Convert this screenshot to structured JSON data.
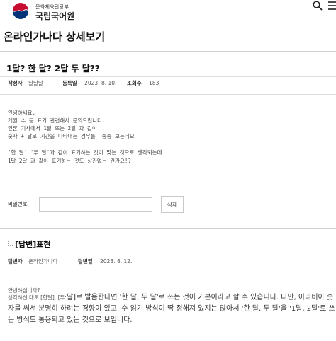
{
  "header": {
    "org_small": "문화체육관광부",
    "org_big": "국립국어원"
  },
  "page_title": "온라인가나다 상세보기",
  "question": {
    "title": "1달? 한 달? 2달 두 달??",
    "author_label": "작성자",
    "author": "달달달",
    "date_label": "등록일",
    "date": "2023. 8. 10.",
    "views_label": "조회수",
    "views": "183",
    "lines": [
      "안녕하세요.",
      "개월 수 등 표기 관련해서 문의드립니다.",
      "언론 기사에서 1달 또는 2달 과 같이",
      "숫자 + 달로 기간을 나타내는 경우를  종종 보는데요",
      "",
      "'한 달' '두 달'과 같이 표기하는 것이 맞는 것으로 생각되는데",
      "1달 2달 과 같이 표기하는 것도 상관없는 건가요!?"
    ]
  },
  "password": {
    "label": "비밀번호",
    "placeholder": "",
    "value": ""
  },
  "delete_label": "삭제",
  "answer": {
    "title": "[답변]표현",
    "author_label": "답변자",
    "author": "온라인가나다",
    "date_label": "답변일",
    "date": "2023. 8. 12.",
    "greeting": "안녕하십니까?",
    "lead": "생각하신 대로 [한달], [두:",
    "text": "달]로 발음한다면 '한 달, 두 달'로 쓰는 것이 기본이라고 할 수 있습니다. 다만, 아라비아 숫자를 써서 분명히 하려는 경향이 있고, 수 읽기 방식이 딱 정해져 있지는 않아서 '한 달, 두 달'을 '1달, 2달'로 쓰는 방식도 통용되고 있는 것으로 보입니다."
  },
  "colors": {
    "emblem_red": "#c60c30",
    "emblem_blue": "#003478",
    "text_dark": "#222222",
    "rule": "#dedede"
  },
  "icons": [
    "government-emblem-icon",
    "search-icon",
    "menu-icon",
    "answer-bullet-icon"
  ]
}
